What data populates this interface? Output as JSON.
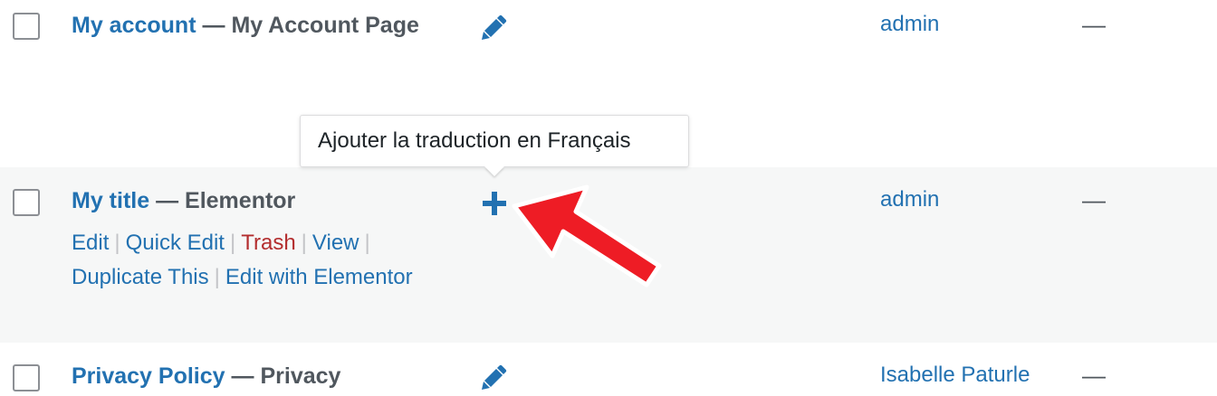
{
  "rows": [
    {
      "title": "My account",
      "separator": " — ",
      "page_state": "My Account Page",
      "language_action_icon": "pencil-icon",
      "author": "admin",
      "date": "—"
    },
    {
      "title": "My title",
      "separator": " — ",
      "page_state": "Elementor",
      "language_action_icon": "plus-icon",
      "author": "admin",
      "date": "—",
      "row_actions": {
        "edit": "Edit",
        "quick_edit": "Quick Edit",
        "trash": "Trash",
        "view": "View",
        "duplicate": "Duplicate This",
        "edit_with_elementor": "Edit with Elementor",
        "pipe": "|"
      }
    },
    {
      "title": "Privacy Policy",
      "separator": " — ",
      "page_state": "Privacy",
      "language_action_icon": "pencil-icon",
      "author": "Isabelle Paturle",
      "date": "—"
    }
  ],
  "tooltip": {
    "text": "Ajouter la traduction en Français"
  },
  "colors": {
    "link": "#2271b1",
    "trash": "#b32d2e",
    "highlight_row": "#f6f7f7",
    "annotation_arrow": "#ee1c25"
  }
}
